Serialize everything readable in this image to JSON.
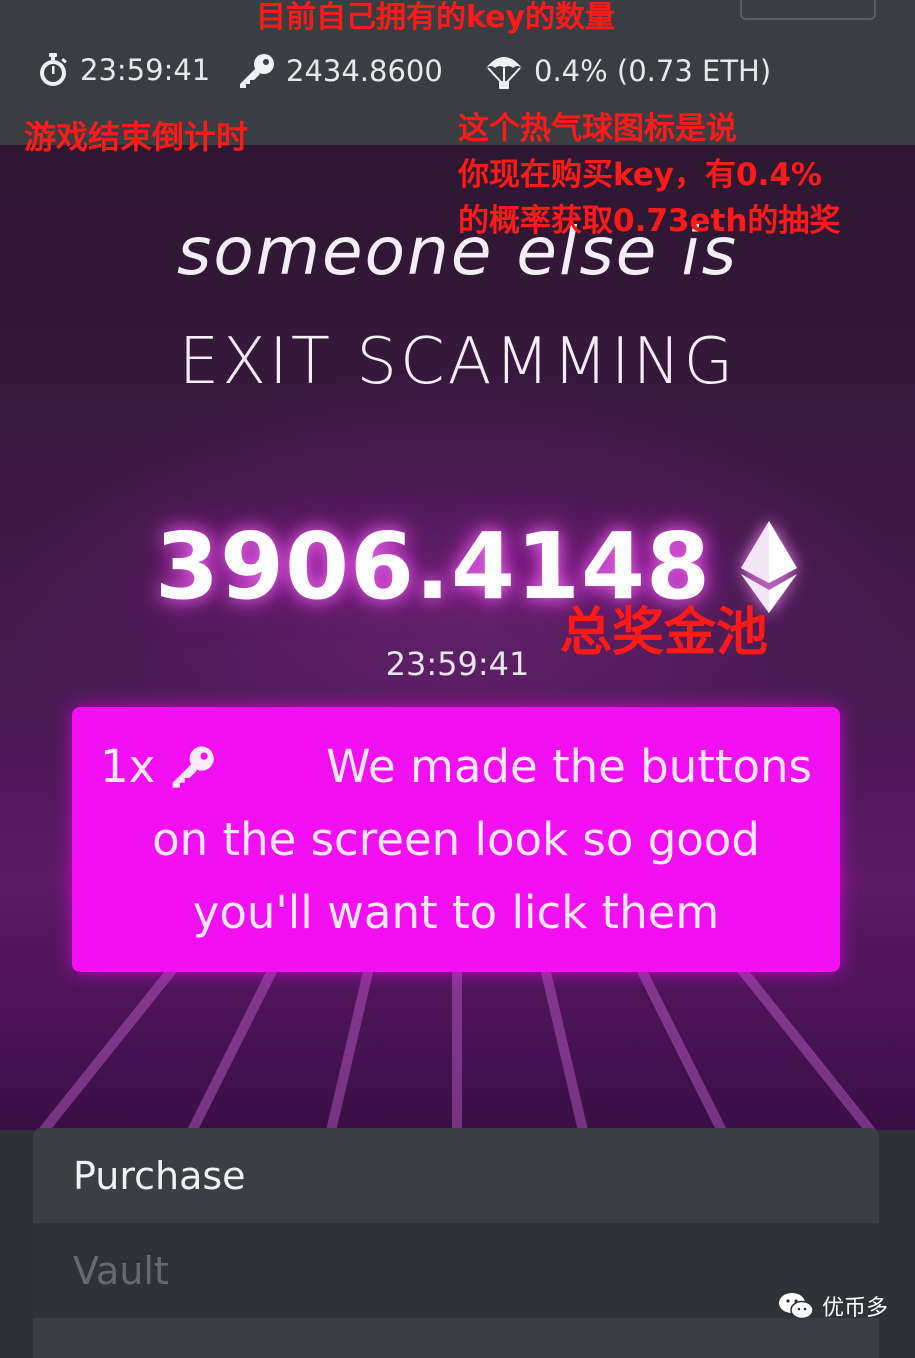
{
  "topbar": {
    "timer": "23:59:41",
    "keys": "2434.8600",
    "airdrop": "0.4% (0.73 ETH)"
  },
  "hero": {
    "headline_1": "someone else is",
    "headline_2": "EXIT SCAMMING",
    "pot_value": "3906.4148",
    "pot_timer": "23:59:41"
  },
  "buy_button": {
    "quantity": "1x",
    "line_1": "We made the buttons",
    "line_2": "on the screen look so good",
    "line_3": "you'll want to lick them"
  },
  "tabs": [
    "Purchase",
    "Vault"
  ],
  "annotations": {
    "keys": "目前自己拥有的key的数量",
    "timer": "游戏结束倒计时",
    "airdrop_1": "这个热气球图标是说",
    "airdrop_2": "你现在购买key，有0.4%",
    "airdrop_3": "的概率获取0.73eth的抽奖",
    "pot": "总奖金池"
  },
  "watermark": "优币多",
  "colors": {
    "accent": "#f20ff2",
    "annotation": "#ff1a1a",
    "topbar": "#3a3d42"
  },
  "icons": {
    "timer": "stopwatch-icon",
    "keys": "key-icon",
    "airdrop": "parachute-icon",
    "pot": "ethereum-icon"
  }
}
